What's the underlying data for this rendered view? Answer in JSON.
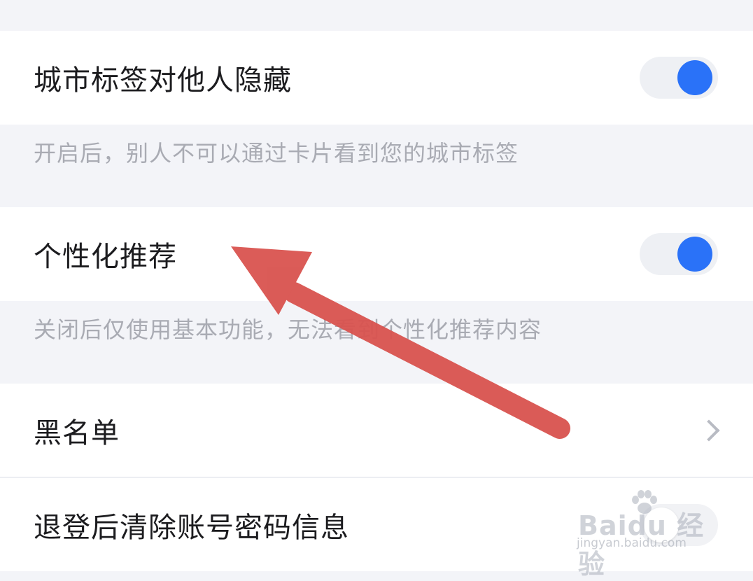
{
  "settings": {
    "city_tag": {
      "label": "城市标签对他人隐藏",
      "hint": "开启后，别人不可以通过卡片看到您的城市标签",
      "enabled": true
    },
    "personalized": {
      "label": "个性化推荐",
      "hint": "关闭后仅使用基本功能，无法看到个性化推荐内容",
      "enabled": true
    },
    "blacklist": {
      "label": "黑名单"
    },
    "clear_password": {
      "label": "退登后清除账号密码信息",
      "enabled": false
    }
  },
  "annotation": {
    "arrow_color": "#d9534f"
  },
  "watermark": {
    "brand": "Baidu 经验",
    "url": "jingyan.baidu.com"
  },
  "colors": {
    "toggle_on": "#2a72f8",
    "background": "#f3f4f8"
  }
}
